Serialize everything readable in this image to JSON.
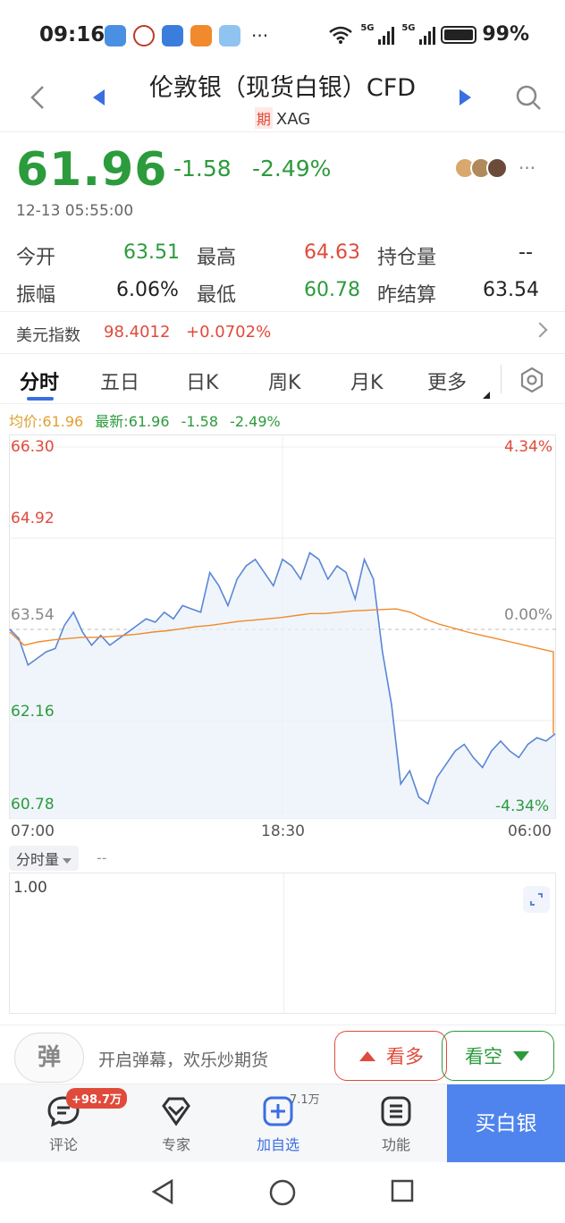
{
  "status_bar": {
    "time": "09:16",
    "more": "···",
    "battery": "99%",
    "signal_1": "5G",
    "signal_2": "5G"
  },
  "header": {
    "title": "伦敦银（现货白银）CFD",
    "badge": "期",
    "code": "XAG"
  },
  "quote": {
    "price": "61.96",
    "change": "-1.58",
    "change_pct": "-2.49%",
    "timestamp": "12-13 05:55:00"
  },
  "stats": {
    "open_label": "今开",
    "open": "63.51",
    "high_label": "最高",
    "high": "64.63",
    "oi_label": "持仓量",
    "oi": "--",
    "amp_label": "振幅",
    "amp": "6.06%",
    "low_label": "最低",
    "low": "60.78",
    "settle_label": "昨结算",
    "settle": "63.54"
  },
  "index": {
    "label": "美元指数",
    "value": "98.4012",
    "change": "+0.0702%"
  },
  "tabs": [
    "分时",
    "五日",
    "日K",
    "周K",
    "月K",
    "更多"
  ],
  "avg_line": {
    "avg": "均价:61.96",
    "latest": "最新:61.96",
    "change": "-1.58",
    "pct": "-2.49%"
  },
  "chart_data": {
    "type": "line",
    "title": "",
    "y_left_ticks": [
      "66.30",
      "64.92",
      "63.54",
      "62.16",
      "60.78"
    ],
    "y_right_ticks": [
      "4.34%",
      "0.00%",
      "-4.34%"
    ],
    "x_ticks": [
      "07:00",
      "18:30",
      "06:00"
    ],
    "ylim": [
      60.78,
      66.3
    ],
    "reference": 63.54,
    "series": [
      {
        "values": [
          63.54,
          63.4,
          63.0,
          63.1,
          63.2,
          63.25,
          63.6,
          63.8,
          63.5,
          63.3,
          63.45,
          63.3,
          63.4,
          63.5,
          63.6,
          63.7,
          63.65,
          63.8,
          63.7,
          63.9,
          63.85,
          63.8,
          64.4,
          64.2,
          63.9,
          64.3,
          64.5,
          64.6,
          64.4,
          64.2,
          64.6,
          64.5,
          64.3,
          64.7,
          64.6,
          64.3,
          64.5,
          64.4,
          64.0,
          64.6,
          64.3,
          63.2,
          62.4,
          61.2,
          61.4,
          61.0,
          60.9,
          61.3,
          61.5,
          61.7,
          61.8,
          61.6,
          61.45,
          61.7,
          61.85,
          61.7,
          61.6,
          61.8,
          61.9,
          61.85,
          61.96
        ]
      },
      {
        "values": [
          63.5,
          63.3,
          63.35,
          63.38,
          63.4,
          63.42,
          63.42,
          63.43,
          63.45,
          63.47,
          63.5,
          63.52,
          63.55,
          63.58,
          63.6,
          63.63,
          63.66,
          63.68,
          63.7,
          63.72,
          63.75,
          63.78,
          63.78,
          63.8,
          63.82,
          63.83,
          63.84,
          63.85,
          63.8,
          63.7,
          63.62,
          63.56,
          63.5,
          63.45,
          63.4,
          63.35,
          63.3,
          63.25,
          63.2,
          61.96
        ]
      }
    ]
  },
  "volume": {
    "selector": "分时量",
    "dash": "--",
    "value": "1.00"
  },
  "danmu": {
    "icon_char": "弹",
    "text": "开启弹幕，欢乐炒期货",
    "bull": "看多",
    "bear": "看空"
  },
  "bottom_nav": {
    "comment_badge": "+98.7万",
    "comment": "评论",
    "expert": "专家",
    "add_count": "7.1万",
    "add": "加自选",
    "func": "功能",
    "buy": "买白银"
  },
  "colors": {
    "up": "#e04a3a",
    "down": "#2c9b3c",
    "accent": "#3a6fe0",
    "price_line": "#5a86d6",
    "avg_line": "#f08a2c"
  }
}
